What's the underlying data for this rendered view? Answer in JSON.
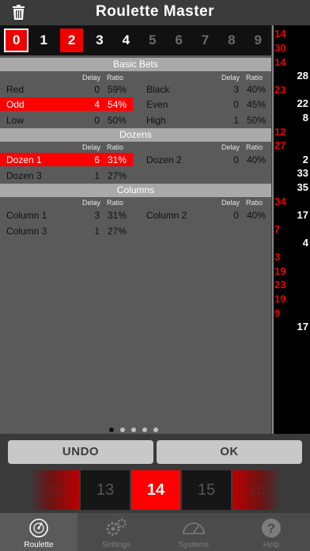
{
  "app": {
    "title": "Roulette Master"
  },
  "number_strip": [
    "0",
    "1",
    "2",
    "3",
    "4",
    "5",
    "6",
    "7",
    "8",
    "9"
  ],
  "sections": [
    {
      "title": "Basic Bets",
      "headers": {
        "delay": "Delay",
        "ratio": "Ratio"
      },
      "rows": [
        {
          "left": {
            "label": "Red",
            "delay": "0",
            "ratio": "59%"
          },
          "right": {
            "label": "Black",
            "delay": "3",
            "ratio": "40%"
          }
        },
        {
          "left": {
            "label": "Odd",
            "delay": "4",
            "ratio": "54%"
          },
          "right": {
            "label": "Even",
            "delay": "0",
            "ratio": "45%"
          }
        },
        {
          "left": {
            "label": "Low",
            "delay": "0",
            "ratio": "50%"
          },
          "right": {
            "label": "High",
            "delay": "1",
            "ratio": "50%"
          }
        }
      ]
    },
    {
      "title": "Dozens",
      "headers": {
        "delay": "Delay",
        "ratio": "Ratio"
      },
      "rows": [
        {
          "left": {
            "label": "Dozen 1",
            "delay": "6",
            "ratio": "31%"
          },
          "right": {
            "label": "Dozen 2",
            "delay": "0",
            "ratio": "40%"
          }
        },
        {
          "left": {
            "label": "Dozen 3",
            "delay": "1",
            "ratio": "27%"
          }
        }
      ]
    },
    {
      "title": "Columns",
      "headers": {
        "delay": "Delay",
        "ratio": "Ratio"
      },
      "rows": [
        {
          "left": {
            "label": "Column 1",
            "delay": "3",
            "ratio": "31%"
          },
          "right": {
            "label": "Column 2",
            "delay": "0",
            "ratio": "40%"
          }
        },
        {
          "left": {
            "label": "Column 3",
            "delay": "1",
            "ratio": "27%"
          }
        }
      ]
    }
  ],
  "history": [
    {
      "n": "14",
      "c": "red"
    },
    {
      "n": "30",
      "c": "red"
    },
    {
      "n": "14",
      "c": "red"
    },
    {
      "n": "28",
      "c": "black"
    },
    {
      "n": "23",
      "c": "red"
    },
    {
      "n": "22",
      "c": "black"
    },
    {
      "n": "8",
      "c": "black"
    },
    {
      "n": "12",
      "c": "red"
    },
    {
      "n": "27",
      "c": "red"
    },
    {
      "n": "2",
      "c": "black"
    },
    {
      "n": "33",
      "c": "black"
    },
    {
      "n": "35",
      "c": "black"
    },
    {
      "n": "34",
      "c": "red"
    },
    {
      "n": "17",
      "c": "black"
    },
    {
      "n": "7",
      "c": "red"
    },
    {
      "n": "4",
      "c": "black"
    },
    {
      "n": "3",
      "c": "red"
    },
    {
      "n": "19",
      "c": "red"
    },
    {
      "n": "23",
      "c": "red"
    },
    {
      "n": "19",
      "c": "red"
    },
    {
      "n": "9",
      "c": "red"
    },
    {
      "n": "17",
      "c": "black"
    }
  ],
  "buttons": {
    "undo": "UNDO",
    "ok": "OK"
  },
  "wheel": [
    "12",
    "13",
    "14",
    "15",
    "16"
  ],
  "tabs": [
    "Roulette",
    "Settings",
    "Systems",
    "Help"
  ],
  "colors": {
    "red": "#ff0000",
    "panel": "#5a5a5a",
    "section": "#a9a9a9"
  }
}
